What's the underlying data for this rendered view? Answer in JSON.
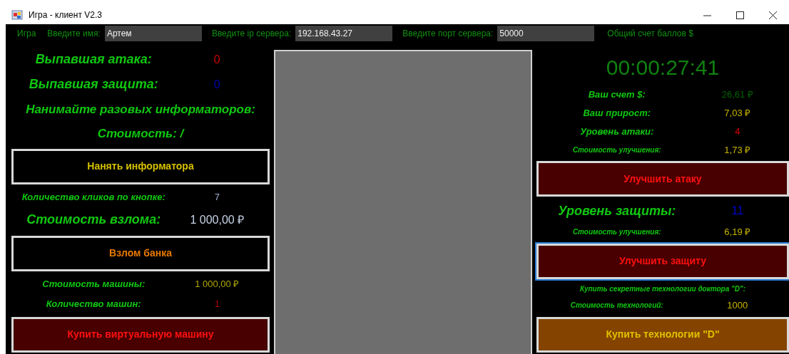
{
  "window": {
    "title": "Игра - клиент V2.3"
  },
  "menu_bar": {
    "menu": "Игра",
    "fields": [
      {
        "label": "Введите имя:",
        "value": "Артем"
      },
      {
        "label": "Введите ip сервера:",
        "value": "192.168.43.27"
      },
      {
        "label": "Введите порт сервера:",
        "value": "50000"
      }
    ],
    "total_label": "Общий счет баллов $"
  },
  "left_panel": [
    {
      "kind": "stat",
      "label": "Выпавшая атака:",
      "value": "0",
      "color": "#cc0000"
    },
    {
      "kind": "stat",
      "label": "Выпавшая защита:",
      "value": "0",
      "color": "#0000aa"
    },
    {
      "kind": "heading",
      "label": "Нанимайте разовых информаторов:"
    },
    {
      "kind": "heading",
      "label": "Стоимость: /"
    },
    {
      "kind": "button",
      "label": "Нанять информатора",
      "focused": false
    },
    {
      "kind": "stat",
      "label": "Количество кликов по кнопке:",
      "value": "7",
      "color": "#a0b0d0"
    },
    {
      "kind": "stat",
      "label": "Стоимость взлома:",
      "value": "1 000,00 ₽",
      "color": "#c8d4e8"
    },
    {
      "kind": "button",
      "label": "Взлом банка",
      "focused": false
    },
    {
      "kind": "stat",
      "label": "Стоимость машины:",
      "value": "1 000,00 ₽",
      "color": "#b0a800"
    },
    {
      "kind": "stat",
      "label": "Количество машин:",
      "value": "1",
      "color": "#b00000"
    },
    {
      "kind": "button",
      "label": "Купить виртуальную машину",
      "focused": false
    }
  ],
  "right_panel": [
    {
      "kind": "timer",
      "label": "00:00:27:41"
    },
    {
      "kind": "stat",
      "label": "Ваш счет $:",
      "value": "26,61 ₽",
      "color": "#006400"
    },
    {
      "kind": "stat",
      "label": "Ваш прирост:",
      "value": "7,03 ₽",
      "color": "#c8b400"
    },
    {
      "kind": "stat",
      "label": "Уровень атаки:",
      "value": "4",
      "color": "#e00000"
    },
    {
      "kind": "stat",
      "label": "Стоимость улучшения:",
      "value": "1,73 ₽",
      "color": "#c8b400"
    },
    {
      "kind": "button",
      "label": "Улучшить атаку",
      "focused": false
    },
    {
      "kind": "stat",
      "label": "Уровень защиты:",
      "value": "11",
      "color": "#0000cc"
    },
    {
      "kind": "stat",
      "label": "Стоимость улучшения:",
      "value": "6,19 ₽",
      "color": "#c8b400"
    },
    {
      "kind": "button",
      "label": "Улучшить защиту",
      "focused": true
    },
    {
      "kind": "heading",
      "label": "Купить секретные технологии доктора \"D\":"
    },
    {
      "kind": "stat",
      "label": "Стоимость технологий:",
      "value": "1000",
      "color": "#c8b400"
    },
    {
      "kind": "button",
      "label": "Купить технологии \"D\"",
      "focused": false
    }
  ]
}
